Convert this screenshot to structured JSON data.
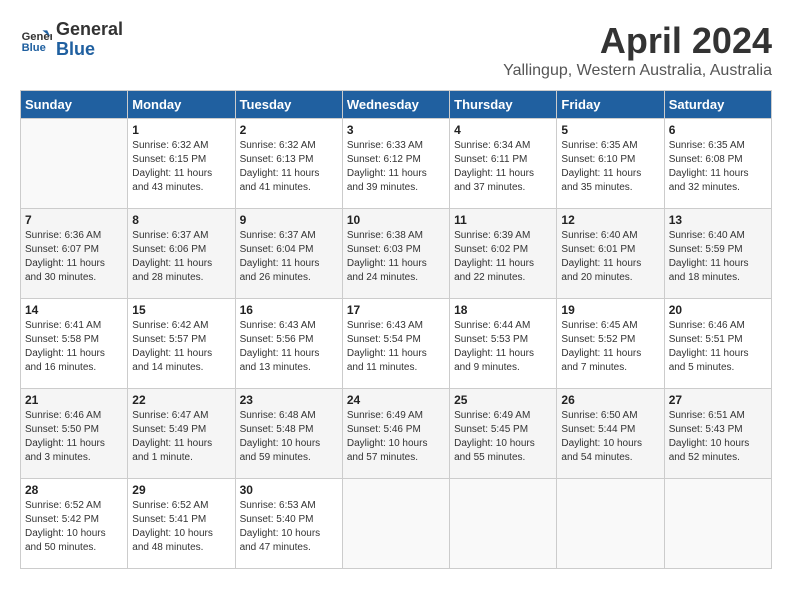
{
  "header": {
    "logo_line1": "General",
    "logo_line2": "Blue",
    "month_title": "April 2024",
    "location": "Yallingup, Western Australia, Australia"
  },
  "days_of_week": [
    "Sunday",
    "Monday",
    "Tuesday",
    "Wednesday",
    "Thursday",
    "Friday",
    "Saturday"
  ],
  "weeks": [
    [
      {
        "day": "",
        "info": ""
      },
      {
        "day": "1",
        "info": "Sunrise: 6:32 AM\nSunset: 6:15 PM\nDaylight: 11 hours\nand 43 minutes."
      },
      {
        "day": "2",
        "info": "Sunrise: 6:32 AM\nSunset: 6:13 PM\nDaylight: 11 hours\nand 41 minutes."
      },
      {
        "day": "3",
        "info": "Sunrise: 6:33 AM\nSunset: 6:12 PM\nDaylight: 11 hours\nand 39 minutes."
      },
      {
        "day": "4",
        "info": "Sunrise: 6:34 AM\nSunset: 6:11 PM\nDaylight: 11 hours\nand 37 minutes."
      },
      {
        "day": "5",
        "info": "Sunrise: 6:35 AM\nSunset: 6:10 PM\nDaylight: 11 hours\nand 35 minutes."
      },
      {
        "day": "6",
        "info": "Sunrise: 6:35 AM\nSunset: 6:08 PM\nDaylight: 11 hours\nand 32 minutes."
      }
    ],
    [
      {
        "day": "7",
        "info": "Sunrise: 6:36 AM\nSunset: 6:07 PM\nDaylight: 11 hours\nand 30 minutes."
      },
      {
        "day": "8",
        "info": "Sunrise: 6:37 AM\nSunset: 6:06 PM\nDaylight: 11 hours\nand 28 minutes."
      },
      {
        "day": "9",
        "info": "Sunrise: 6:37 AM\nSunset: 6:04 PM\nDaylight: 11 hours\nand 26 minutes."
      },
      {
        "day": "10",
        "info": "Sunrise: 6:38 AM\nSunset: 6:03 PM\nDaylight: 11 hours\nand 24 minutes."
      },
      {
        "day": "11",
        "info": "Sunrise: 6:39 AM\nSunset: 6:02 PM\nDaylight: 11 hours\nand 22 minutes."
      },
      {
        "day": "12",
        "info": "Sunrise: 6:40 AM\nSunset: 6:01 PM\nDaylight: 11 hours\nand 20 minutes."
      },
      {
        "day": "13",
        "info": "Sunrise: 6:40 AM\nSunset: 5:59 PM\nDaylight: 11 hours\nand 18 minutes."
      }
    ],
    [
      {
        "day": "14",
        "info": "Sunrise: 6:41 AM\nSunset: 5:58 PM\nDaylight: 11 hours\nand 16 minutes."
      },
      {
        "day": "15",
        "info": "Sunrise: 6:42 AM\nSunset: 5:57 PM\nDaylight: 11 hours\nand 14 minutes."
      },
      {
        "day": "16",
        "info": "Sunrise: 6:43 AM\nSunset: 5:56 PM\nDaylight: 11 hours\nand 13 minutes."
      },
      {
        "day": "17",
        "info": "Sunrise: 6:43 AM\nSunset: 5:54 PM\nDaylight: 11 hours\nand 11 minutes."
      },
      {
        "day": "18",
        "info": "Sunrise: 6:44 AM\nSunset: 5:53 PM\nDaylight: 11 hours\nand 9 minutes."
      },
      {
        "day": "19",
        "info": "Sunrise: 6:45 AM\nSunset: 5:52 PM\nDaylight: 11 hours\nand 7 minutes."
      },
      {
        "day": "20",
        "info": "Sunrise: 6:46 AM\nSunset: 5:51 PM\nDaylight: 11 hours\nand 5 minutes."
      }
    ],
    [
      {
        "day": "21",
        "info": "Sunrise: 6:46 AM\nSunset: 5:50 PM\nDaylight: 11 hours\nand 3 minutes."
      },
      {
        "day": "22",
        "info": "Sunrise: 6:47 AM\nSunset: 5:49 PM\nDaylight: 11 hours\nand 1 minute."
      },
      {
        "day": "23",
        "info": "Sunrise: 6:48 AM\nSunset: 5:48 PM\nDaylight: 10 hours\nand 59 minutes."
      },
      {
        "day": "24",
        "info": "Sunrise: 6:49 AM\nSunset: 5:46 PM\nDaylight: 10 hours\nand 57 minutes."
      },
      {
        "day": "25",
        "info": "Sunrise: 6:49 AM\nSunset: 5:45 PM\nDaylight: 10 hours\nand 55 minutes."
      },
      {
        "day": "26",
        "info": "Sunrise: 6:50 AM\nSunset: 5:44 PM\nDaylight: 10 hours\nand 54 minutes."
      },
      {
        "day": "27",
        "info": "Sunrise: 6:51 AM\nSunset: 5:43 PM\nDaylight: 10 hours\nand 52 minutes."
      }
    ],
    [
      {
        "day": "28",
        "info": "Sunrise: 6:52 AM\nSunset: 5:42 PM\nDaylight: 10 hours\nand 50 minutes."
      },
      {
        "day": "29",
        "info": "Sunrise: 6:52 AM\nSunset: 5:41 PM\nDaylight: 10 hours\nand 48 minutes."
      },
      {
        "day": "30",
        "info": "Sunrise: 6:53 AM\nSunset: 5:40 PM\nDaylight: 10 hours\nand 47 minutes."
      },
      {
        "day": "",
        "info": ""
      },
      {
        "day": "",
        "info": ""
      },
      {
        "day": "",
        "info": ""
      },
      {
        "day": "",
        "info": ""
      }
    ]
  ]
}
